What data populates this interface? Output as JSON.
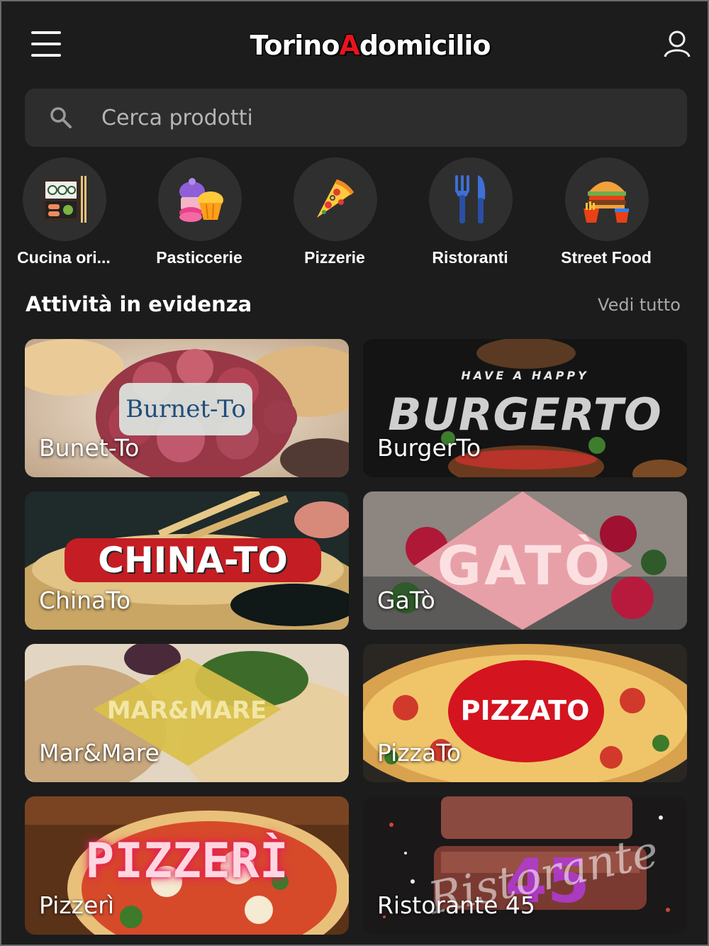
{
  "header": {
    "logo_part1": "Torino",
    "logo_accent": "A",
    "logo_part2": "domicilio"
  },
  "search": {
    "placeholder": "Cerca prodotti"
  },
  "categories": [
    {
      "label": "Cucina ori...",
      "icon": "sushi-box-icon"
    },
    {
      "label": "Pasticcerie",
      "icon": "cupcake-icon"
    },
    {
      "label": "Pizzerie",
      "icon": "pizza-slice-icon"
    },
    {
      "label": "Ristoranti",
      "icon": "fork-knife-icon"
    },
    {
      "label": "Street Food",
      "icon": "burger-fries-icon"
    }
  ],
  "featured": {
    "title": "Attività in evidenza",
    "see_all": "Vedi tutto",
    "items": [
      {
        "name": "Bunet-To",
        "brand": "Burnet-To"
      },
      {
        "name": "BurgerTo",
        "brand_top": "HAVE A HAPPY",
        "brand": "BURGERTO"
      },
      {
        "name": "ChinaTo",
        "brand": "CHINA-TO"
      },
      {
        "name": "GaTò",
        "brand": "GATÒ"
      },
      {
        "name": "Mar&Mare",
        "brand": "MAR&MARE"
      },
      {
        "name": "PizzaTo",
        "brand": "PIZZATO"
      },
      {
        "name": "Pizzerì",
        "brand": "PIZZERÌ"
      },
      {
        "name": "Ristorante 45",
        "brand": "Ristorante",
        "brand_num": "45"
      }
    ]
  },
  "colors": {
    "background": "#1c1c1c",
    "surface": "#2d2d2d",
    "accent": "#e8141c"
  }
}
